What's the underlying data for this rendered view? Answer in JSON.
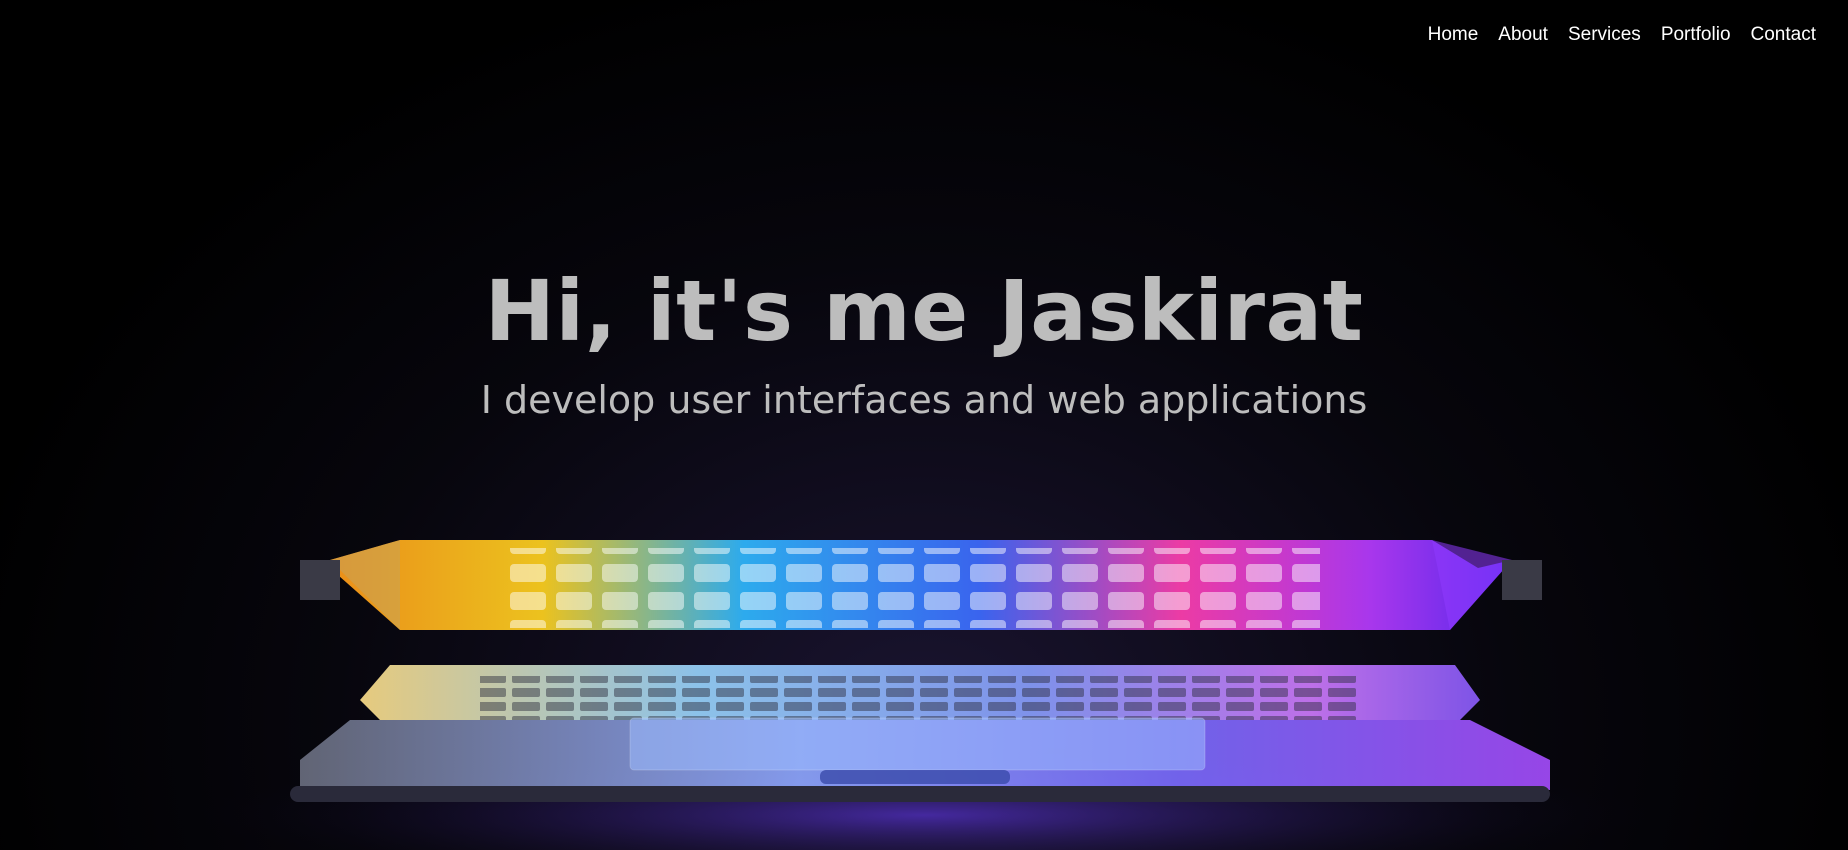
{
  "nav": {
    "items": [
      {
        "label": "Home"
      },
      {
        "label": "About"
      },
      {
        "label": "Services"
      },
      {
        "label": "Portfolio"
      },
      {
        "label": "Contact"
      }
    ]
  },
  "hero": {
    "title": "Hi, it's me Jaskirat",
    "subtitle": "I develop user interfaces and web applications",
    "text_color": "#bdbdbd",
    "background_color": "#000000"
  },
  "image": {
    "icon": "laptop-keyboard-reflection-image"
  }
}
